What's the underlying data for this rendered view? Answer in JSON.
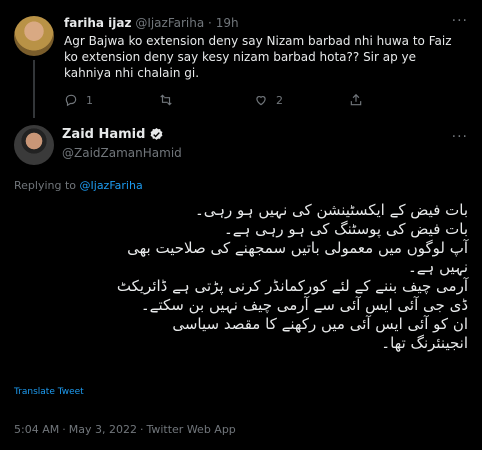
{
  "reply": {
    "name": "fariha ijaz",
    "handle": "@IjazFariha",
    "dot": "·",
    "time": "19h",
    "more": "···",
    "text": "Agr Bajwa ko extension deny say Nizam barbad nhi huwa to Faiz ko extension deny say kesy nizam barbad hota?? Sir ap ye kahniya nhi chalain gi.",
    "reply_count": "1",
    "retweet_count": "",
    "like_count": "2",
    "share_count": ""
  },
  "tweet": {
    "name": "Zaid Hamid",
    "handle": "@ZaidZamanHamid",
    "more": "···",
    "replying_prefix": "Replying to ",
    "replying_mention": "@IjazFariha",
    "lines": [
      "بات فیض کے ایکسٹینشن کی نہیں ہو رہی۔",
      "بات فیض کی پوسٹنگ کی ہو رہی ہے۔",
      "آپ لوگوں میں معمولی باتیں سمجھنے کی صلاحیت بھی",
      "نہیں ہے۔",
      "آرمی چیف بننے کے لئے کورکمانڈر کرنی پڑتی ہے ڈائریکٹ",
      "ڈی جی آئی ایس آئی سے آرمی چیف نہیں بن سکتے۔",
      "ان کو آئی ایس آئی میں رکھنے کا مقصد سیاسی",
      "انجینئرنگ تھا۔"
    ],
    "translate": "Translate Tweet",
    "time": "5:04 AM",
    "date": "May 3, 2022",
    "source": "Twitter Web App",
    "dot": "·"
  },
  "colors": {
    "background": "#000000",
    "text": "#e7e9ea",
    "muted": "#71767b",
    "link": "#1d9bf0"
  },
  "icons": [
    "reply-icon",
    "retweet-icon",
    "like-icon",
    "share-icon",
    "verified-badge-icon",
    "more-icon"
  ]
}
